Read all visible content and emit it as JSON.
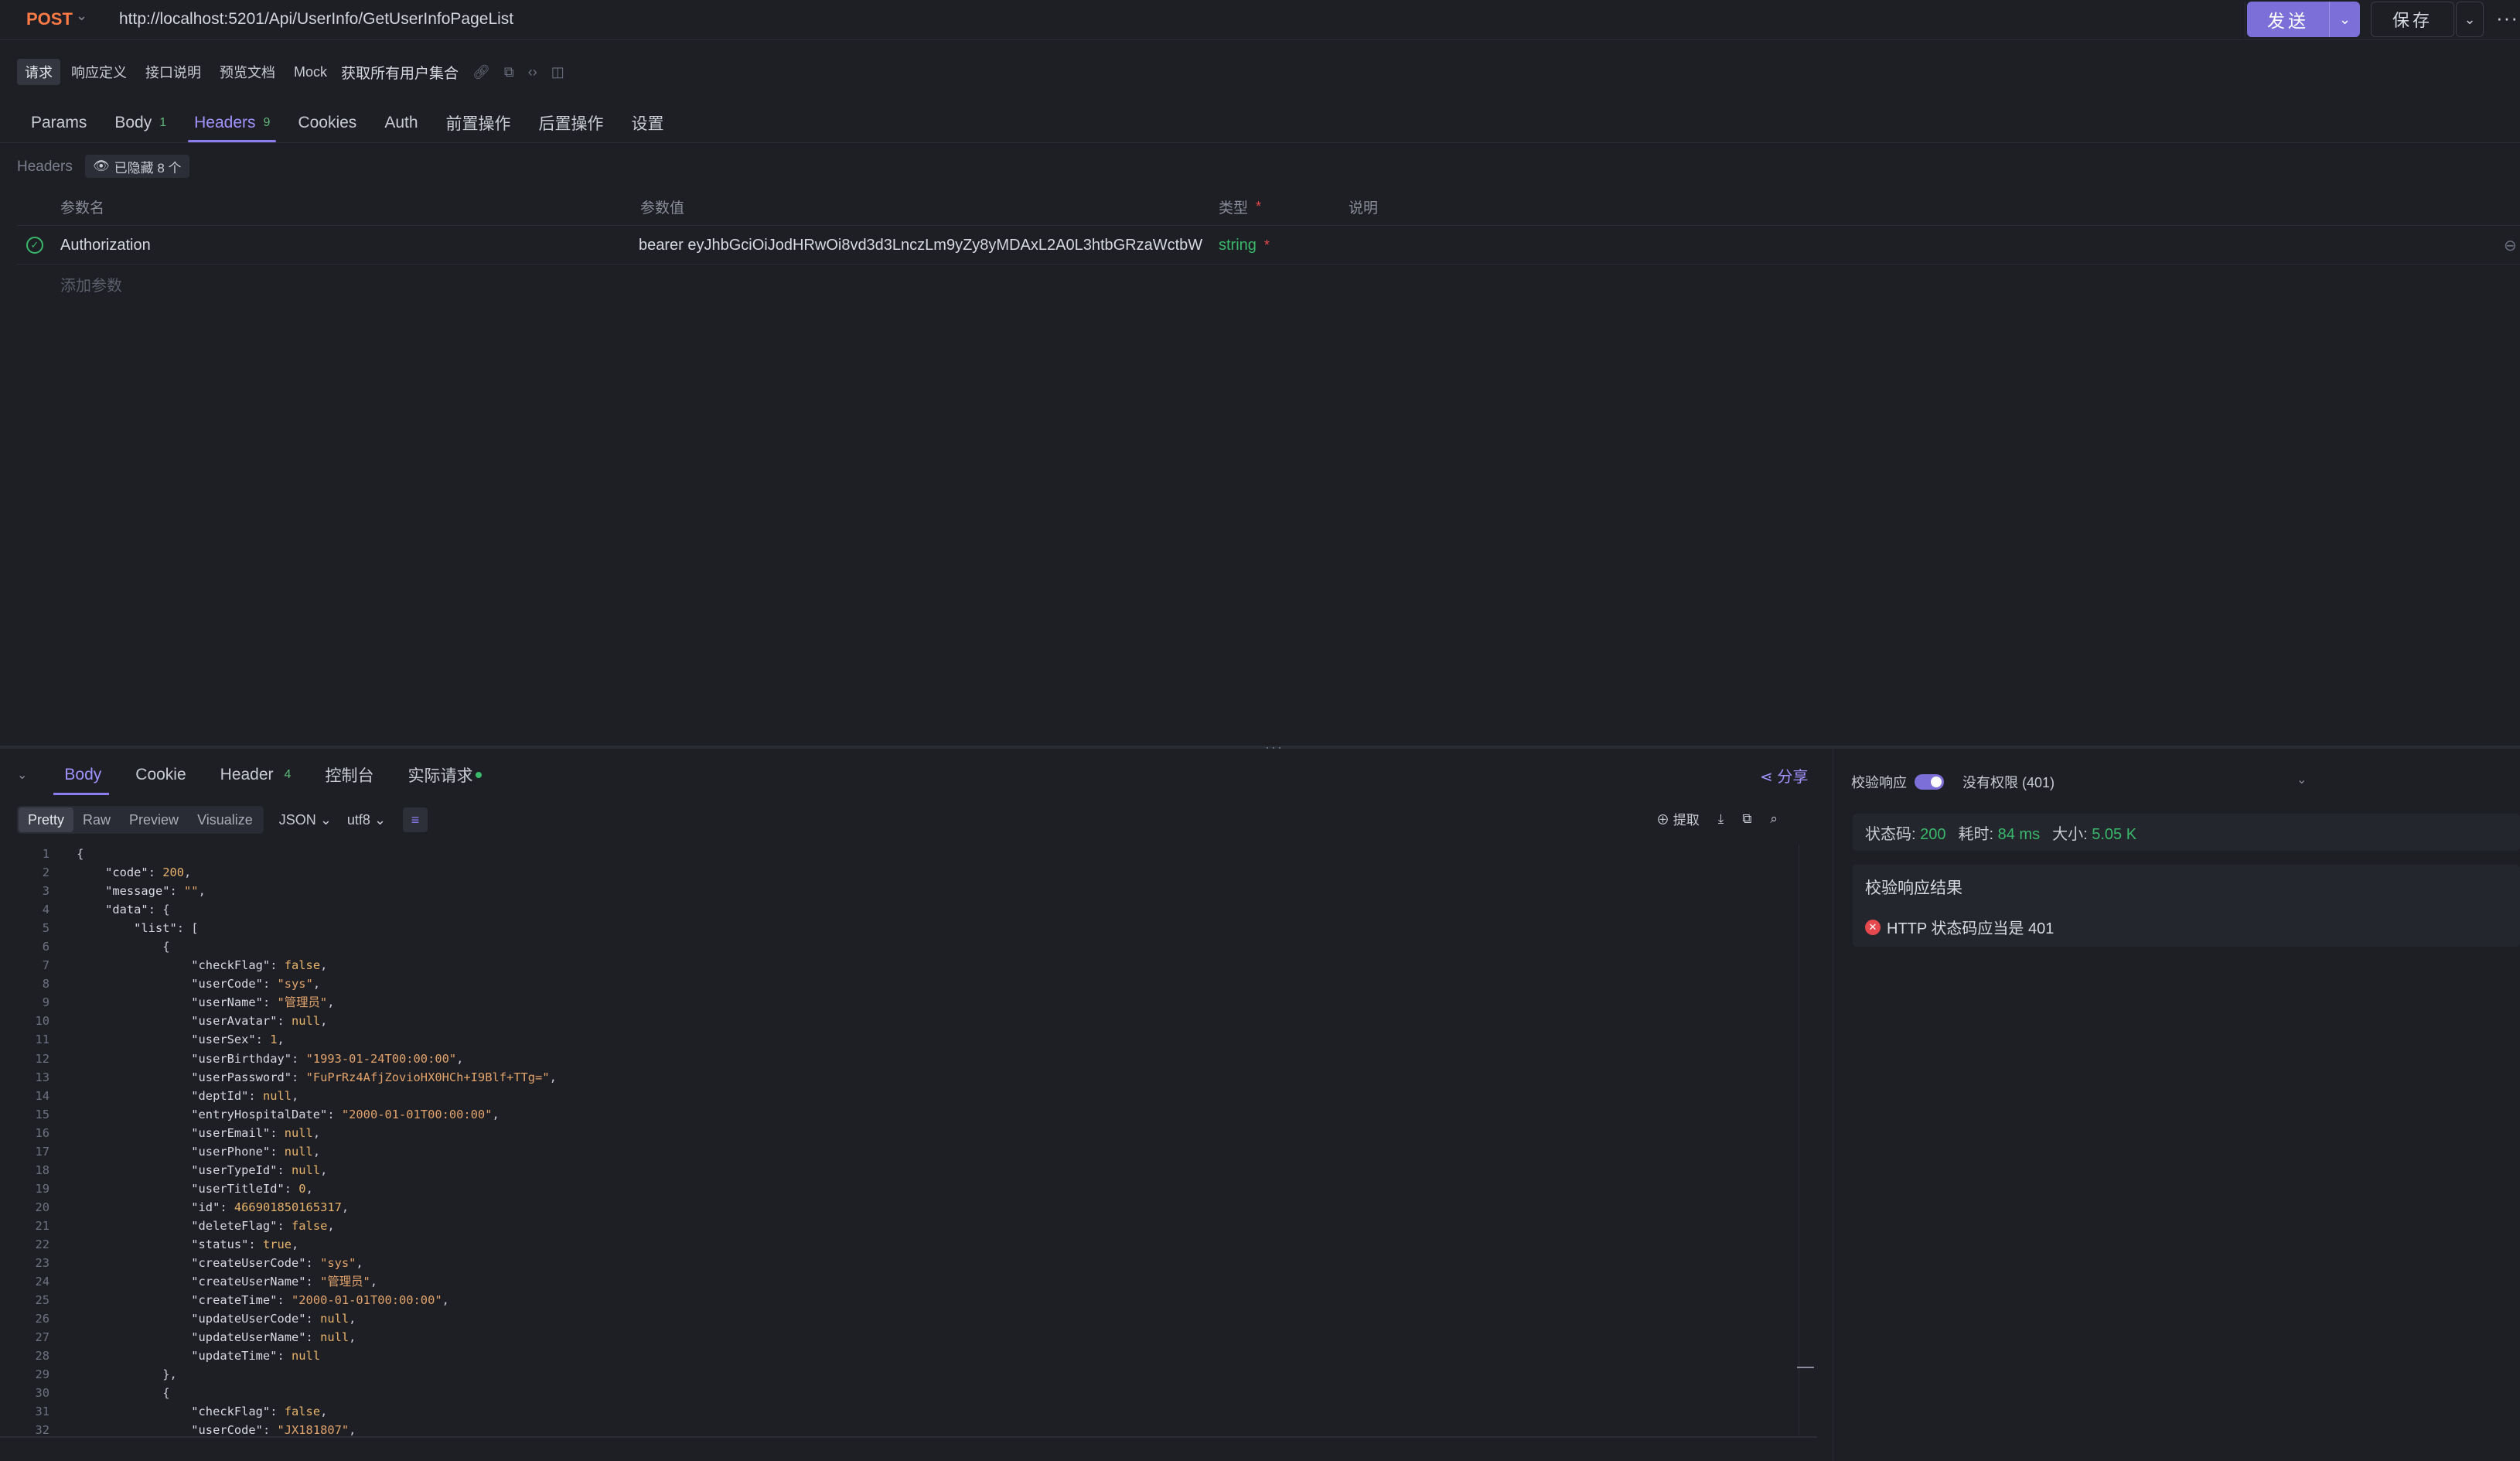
{
  "urlbar": {
    "method": "POST",
    "url": "http://localhost:5201/Api/UserInfo/GetUserInfoPageList",
    "send": "发送",
    "save": "保存"
  },
  "subtabs": {
    "items": [
      "请求",
      "响应定义",
      "接口说明",
      "预览文档",
      "Mock"
    ],
    "title": "获取所有用户集合"
  },
  "reqtabs": [
    {
      "label": "Params",
      "count": ""
    },
    {
      "label": "Body",
      "count": "1"
    },
    {
      "label": "Headers",
      "count": "9"
    },
    {
      "label": "Cookies",
      "count": ""
    },
    {
      "label": "Auth",
      "count": ""
    },
    {
      "label": "前置操作",
      "count": ""
    },
    {
      "label": "后置操作",
      "count": ""
    },
    {
      "label": "设置",
      "count": ""
    }
  ],
  "headers": {
    "label": "Headers",
    "hidden": "已隐藏 8 个",
    "col_name": "参数名",
    "col_value": "参数值",
    "col_type": "类型",
    "col_desc": "说明",
    "row": {
      "name": "Authorization",
      "value": "bearer eyJhbGciOiJodHRwOi8vd3d3LnczLm9yZy8yMDAxL2A0L3htbGRzaWctbW",
      "type": "string"
    },
    "add": "添加参数"
  },
  "resptabs": [
    {
      "label": "Body",
      "count": ""
    },
    {
      "label": "Cookie",
      "count": ""
    },
    {
      "label": "Header",
      "count": "4"
    },
    {
      "label": "控制台",
      "count": ""
    },
    {
      "label": "实际请求",
      "count": ""
    }
  ],
  "share": "分享",
  "viewbar": {
    "modes": [
      "Pretty",
      "Raw",
      "Preview",
      "Visualize"
    ],
    "format": "JSON",
    "encoding": "utf8",
    "extract": "提取"
  },
  "code": [
    "{",
    "    \"code\": 200,",
    "    \"message\": \"\",",
    "    \"data\": {",
    "        \"list\": [",
    "            {",
    "                \"checkFlag\": false,",
    "                \"userCode\": \"sys\",",
    "                \"userName\": \"管理员\",",
    "                \"userAvatar\": null,",
    "                \"userSex\": 1,",
    "                \"userBirthday\": \"1993-01-24T00:00:00\",",
    "                \"userPassword\": \"FuPrRz4AfjZovioHX0HCh+I9Blf+TTg=\",",
    "                \"deptId\": null,",
    "                \"entryHospitalDate\": \"2000-01-01T00:00:00\",",
    "                \"userEmail\": null,",
    "                \"userPhone\": null,",
    "                \"userTypeId\": null,",
    "                \"userTitleId\": 0,",
    "                \"id\": 466901850165317,",
    "                \"deleteFlag\": false,",
    "                \"status\": true,",
    "                \"createUserCode\": \"sys\",",
    "                \"createUserName\": \"管理员\",",
    "                \"createTime\": \"2000-01-01T00:00:00\",",
    "                \"updateUserCode\": null,",
    "                \"updateUserName\": null,",
    "                \"updateTime\": null",
    "            },",
    "            {",
    "                \"checkFlag\": false,",
    "                \"userCode\": \"JX181807\","
  ],
  "validate": {
    "label": "校验响应",
    "status": "没有权限 (401)",
    "code_label": "状态码:",
    "code": "200",
    "time_label": "耗时:",
    "time": "84 ms",
    "size_label": "大小:",
    "size": "5.05 K",
    "result_title": "校验响应结果",
    "result_fail": "HTTP 状态码应当是 401"
  }
}
